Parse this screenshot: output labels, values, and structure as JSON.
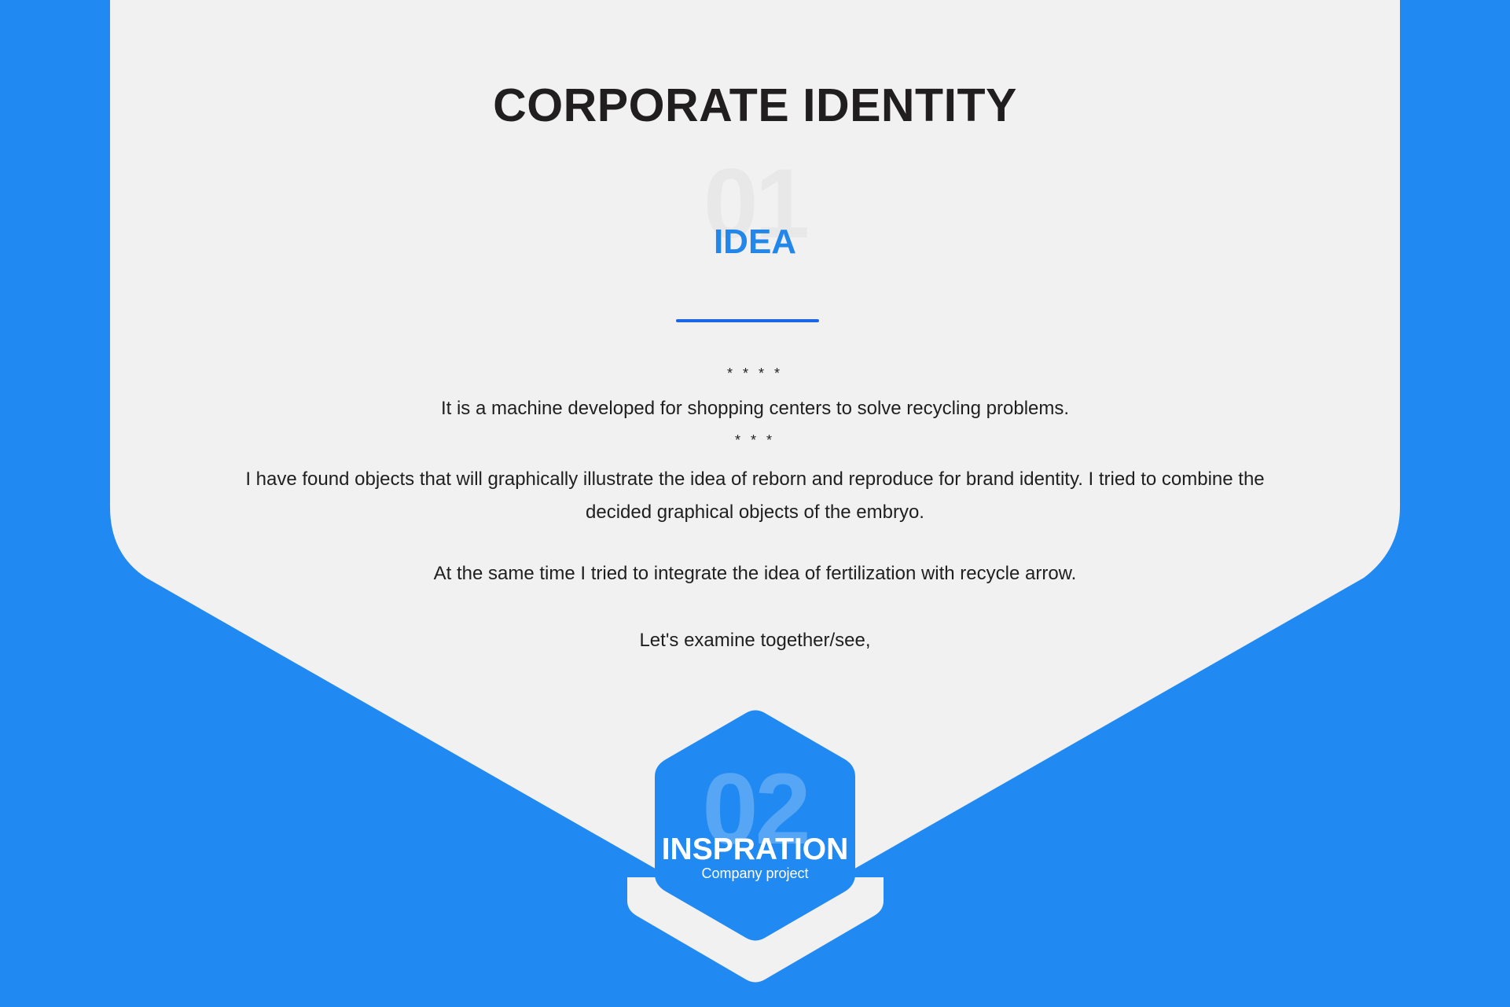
{
  "colors": {
    "background_blue": "#2189f2",
    "panel_light": "#f1f1f1",
    "accent_blue": "#2386ea",
    "divider_blue": "#1b66e6",
    "title_dark": "#201e1e"
  },
  "header": {
    "title": "CORPORATE IDENTITY"
  },
  "section1": {
    "number": "01",
    "heading": "IDEA",
    "stars_top": "* * * *",
    "line1": "It is a machine developed for shopping centers to solve recycling problems.",
    "stars_mid": "* * *",
    "line2": "I have found objects that will graphically illustrate the idea of reborn and reproduce for brand identity. I tried to combine the decided graphical objects of the embryo.",
    "line3": "At the same time I tried to integrate the idea of fertilization with recycle arrow.",
    "line4": "Let's examine together/see,"
  },
  "section2": {
    "number": "02",
    "heading": "INSPRATION",
    "subtitle": "Company project"
  }
}
